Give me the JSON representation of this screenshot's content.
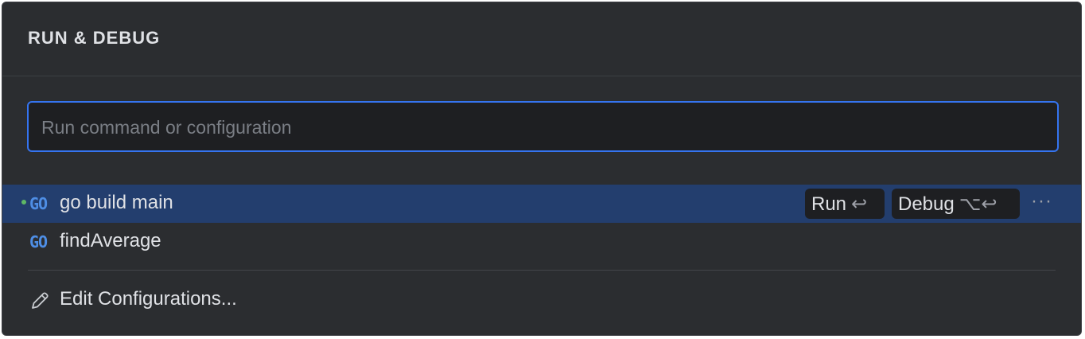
{
  "header": {
    "title": "RUN & DEBUG"
  },
  "search": {
    "placeholder": "Run command or configuration",
    "value": ""
  },
  "items": [
    {
      "icon": "go-icon",
      "icon_text": "GO",
      "label": "go build main",
      "selected": true,
      "running": true
    },
    {
      "icon": "go-icon",
      "icon_text": "GO",
      "label": "findAverage",
      "selected": false
    }
  ],
  "actions": {
    "run_label": "Run",
    "run_shortcut": "↩",
    "debug_label": "Debug",
    "debug_shortcut": "⌥↩",
    "more": "···"
  },
  "footer": {
    "edit_label": "Edit Configurations..."
  },
  "colors": {
    "accent": "#3574f0",
    "selected_row": "#233e6e",
    "background": "#2b2d30",
    "go_icon": "#4e8ee5",
    "run_dot": "#5fb865"
  }
}
